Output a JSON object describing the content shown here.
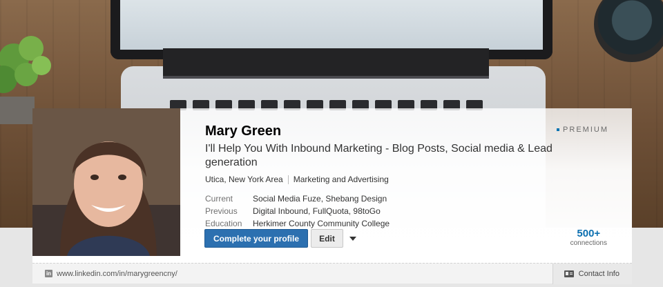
{
  "profile": {
    "name": "Mary Green",
    "premium_label": "PREMIUM",
    "headline": "I'll Help You With Inbound Marketing - Blog Posts, Social media & Lead generation",
    "location": "Utica, New York Area",
    "industry": "Marketing and Advertising",
    "details": [
      {
        "label": "Current",
        "value": "Social Media Fuze, Shebang Design"
      },
      {
        "label": "Previous",
        "value": "Digital Inbound, FullQuota, 98toGo"
      },
      {
        "label": "Education",
        "value": "Herkimer County Community College"
      }
    ],
    "actions": {
      "primary_label": "Complete your profile",
      "edit_label": "Edit"
    },
    "connections": {
      "count": "500+",
      "label": "connections"
    }
  },
  "footer": {
    "profile_url": "www.linkedin.com/in/marygreencny/",
    "contact_label": "Contact Info"
  },
  "icons": {
    "linkedin": "linkedin-icon",
    "dropdown": "chevron-down-icon",
    "contact": "contact-card-icon"
  },
  "colors": {
    "primary_button": "#2c70b0",
    "connections": "#0b6fb0",
    "premium_dot": "#0073b1"
  }
}
